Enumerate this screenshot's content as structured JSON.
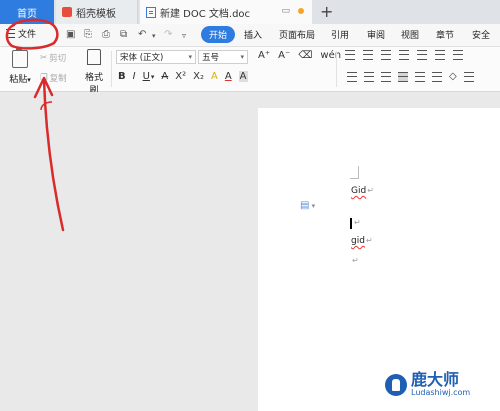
{
  "tabs": {
    "home": "首页",
    "template": "稻壳模板",
    "document": "新建 DOC 文档.doc"
  },
  "menubar": {
    "file": "文件",
    "ribbon_tabs": [
      "开始",
      "插入",
      "页面布局",
      "引用",
      "审阅",
      "视图",
      "章节",
      "安全"
    ],
    "active_tab": "开始"
  },
  "ribbon": {
    "paste": "粘贴",
    "cut": "剪切",
    "copy": "复制",
    "format_painter": "格式刷",
    "font_name": "宋体 (正文)",
    "font_size": "五号"
  },
  "document": {
    "lines": [
      "Gid",
      "",
      "gid",
      ""
    ]
  },
  "watermark": {
    "title": "鹿大师",
    "url": "Ludashiwj.com"
  },
  "colors": {
    "accent": "#2e7ce0",
    "annotation": "#d92b2b"
  }
}
